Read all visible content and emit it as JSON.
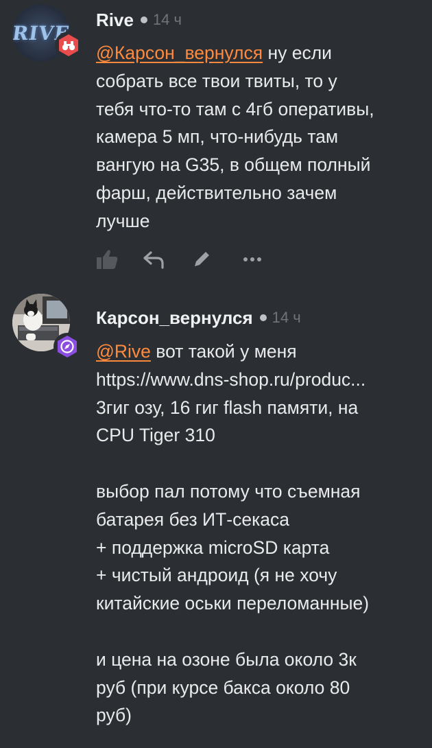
{
  "comments": [
    {
      "author": "Rive",
      "time": "14 ч",
      "avatar_logo": "RIVE",
      "badge_color": "#e84c4c",
      "badge_icon": "binoculars-icon",
      "mention": "@Карсон_вернулся",
      "lines": [
        " ну если",
        "собрать все твои твиты, то у",
        "тебя что-то там с 4гб оперативы,",
        "камера 5 мп, что-нибудь там",
        "вангую на G35, в общем полный",
        "фарш, действительно зачем",
        "лучше"
      ],
      "actions": [
        "like-icon",
        "reply-icon",
        "edit-icon",
        "more-icon"
      ]
    },
    {
      "author": "Карсон_вернулся",
      "time": "14 ч",
      "badge_color": "#8c4ee0",
      "badge_icon": "compass-icon",
      "mention": "@Rive",
      "lines": [
        " вот такой у меня",
        "https://www.dns-shop.ru/produc...",
        "3гиг озу, 16 гиг flash памяти, на",
        "CPU Tiger 310",
        "",
        "выбор пал потому что съемная",
        "батарея без ИТ-секаса",
        "+ поддержка microSD карта",
        "+ чистый андроид (я не хочу",
        "китайские оськи переломанные)",
        "",
        "и цена на озоне была около 3к",
        "руб (при курсе бакса около 80",
        "руб)"
      ]
    }
  ],
  "colors": {
    "background": "#2b2f33",
    "mention": "#ff8a3d",
    "text": "#e9eaeb",
    "muted": "#70757a"
  }
}
